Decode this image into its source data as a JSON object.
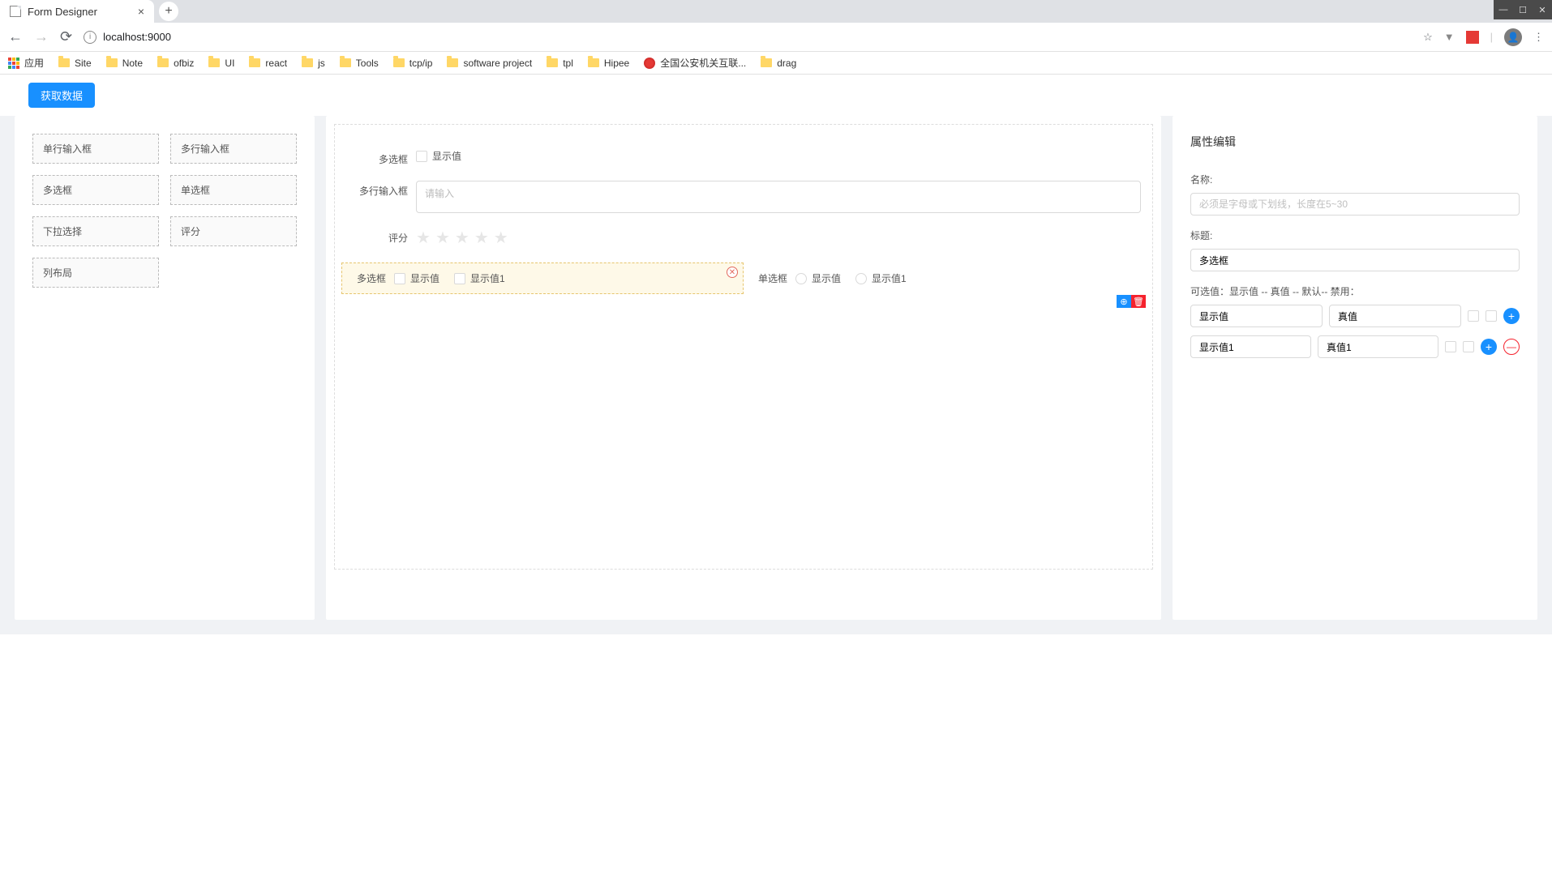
{
  "browser": {
    "tab_title": "Form Designer",
    "url": "localhost:9000",
    "bookmarks": [
      "应用",
      "Site",
      "Note",
      "ofbiz",
      "UI",
      "react",
      "js",
      "Tools",
      "tcp/ip",
      "software project",
      "tpl",
      "Hipee",
      "全国公安机关互联...",
      "drag"
    ]
  },
  "toolbar": {
    "get_data": "获取数据"
  },
  "widgets": [
    "单行输入框",
    "多行输入框",
    "多选框",
    "单选框",
    "下拉选择",
    "评分",
    "列布局"
  ],
  "canvas": {
    "row1": {
      "label": "多选框",
      "opts": [
        "显示值"
      ]
    },
    "row2": {
      "label": "多行输入框",
      "placeholder": "请输入"
    },
    "row3": {
      "label": "评分"
    },
    "row4": {
      "left": {
        "label": "多选框",
        "opts": [
          "显示值",
          "显示值1"
        ]
      },
      "right": {
        "label": "单选框",
        "opts": [
          "显示值",
          "显示值1"
        ]
      }
    }
  },
  "props": {
    "title": "属性编辑",
    "name_label": "名称:",
    "name_placeholder": "必须是字母或下划线，长度在5~30",
    "title_label": "标题:",
    "title_value": "多选框",
    "options_label": "可选值：显示值 -- 真值 -- 默认-- 禁用：",
    "options": [
      {
        "display": "显示值",
        "real": "真值"
      },
      {
        "display": "显示值1",
        "real": "真值1"
      }
    ]
  }
}
